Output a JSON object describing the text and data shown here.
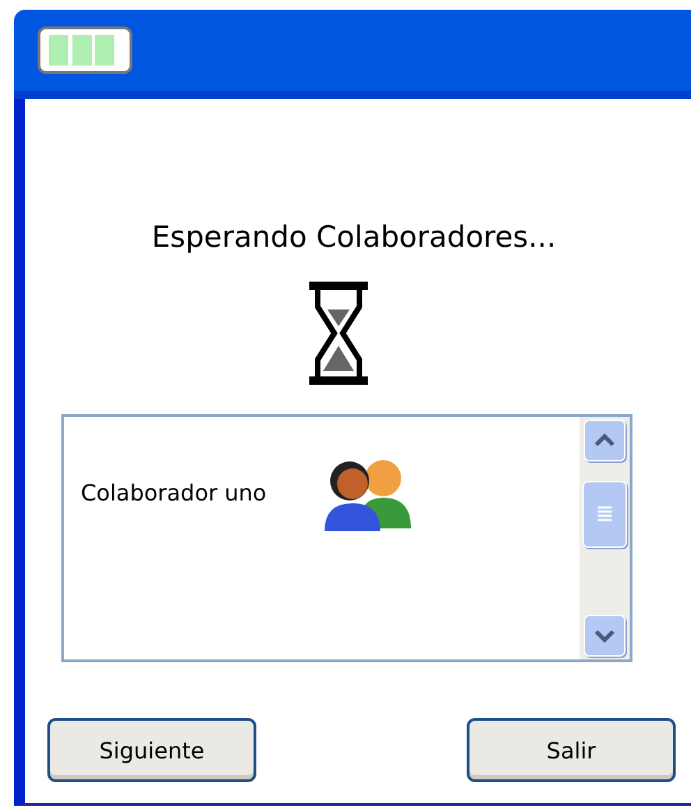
{
  "heading": "Esperando Colaboradores...",
  "collaborators": [
    {
      "name": "Colaborador uno"
    }
  ],
  "buttons": [
    {
      "label": "Siguiente"
    },
    {
      "label": "Salir"
    }
  ]
}
